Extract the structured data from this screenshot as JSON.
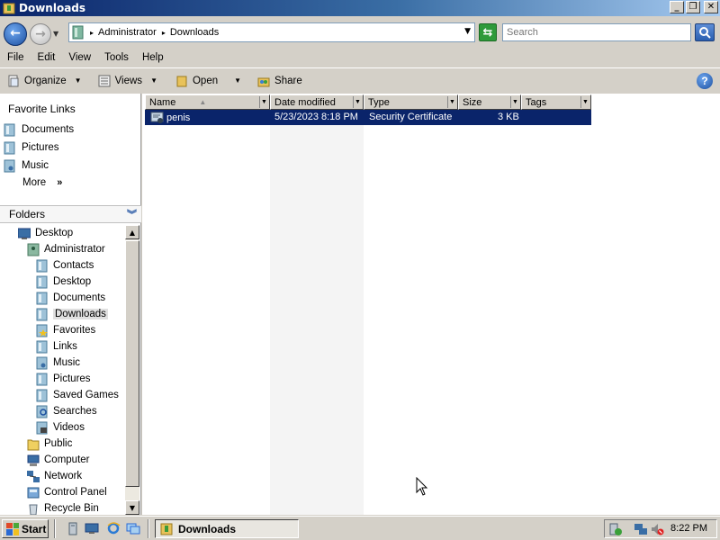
{
  "window": {
    "title": "Downloads",
    "buttons": {
      "minimize": "_",
      "maximize": "❐",
      "close": "✕"
    }
  },
  "address": {
    "crumbs": [
      "Administrator",
      "Downloads"
    ],
    "search_placeholder": "Search"
  },
  "menu": [
    "File",
    "Edit",
    "View",
    "Tools",
    "Help"
  ],
  "toolbar": {
    "organize": "Organize",
    "views": "Views",
    "open": "Open",
    "share": "Share",
    "help": "?"
  },
  "favorites": {
    "header": "Favorite Links",
    "items": [
      "Documents",
      "Pictures",
      "Music"
    ],
    "more": "More",
    "more_chevron": "»"
  },
  "folders": {
    "header": "Folders",
    "tree": [
      {
        "label": "Desktop",
        "level": 1,
        "icon": "desktop-icon"
      },
      {
        "label": "Administrator",
        "level": 2,
        "icon": "user-folder-icon"
      },
      {
        "label": "Contacts",
        "level": 3,
        "icon": "contacts-icon"
      },
      {
        "label": "Desktop",
        "level": 3,
        "icon": "desktop-folder-icon"
      },
      {
        "label": "Documents",
        "level": 3,
        "icon": "documents-icon"
      },
      {
        "label": "Downloads",
        "level": 3,
        "icon": "downloads-icon",
        "selected": true
      },
      {
        "label": "Favorites",
        "level": 3,
        "icon": "favorites-icon"
      },
      {
        "label": "Links",
        "level": 3,
        "icon": "links-icon"
      },
      {
        "label": "Music",
        "level": 3,
        "icon": "music-icon"
      },
      {
        "label": "Pictures",
        "level": 3,
        "icon": "pictures-icon"
      },
      {
        "label": "Saved Games",
        "level": 3,
        "icon": "saved-games-icon"
      },
      {
        "label": "Searches",
        "level": 3,
        "icon": "searches-icon"
      },
      {
        "label": "Videos",
        "level": 3,
        "icon": "videos-icon"
      },
      {
        "label": "Public",
        "level": 2,
        "icon": "folder-icon"
      },
      {
        "label": "Computer",
        "level": 2,
        "icon": "computer-icon"
      },
      {
        "label": "Network",
        "level": 2,
        "icon": "network-icon"
      },
      {
        "label": "Control Panel",
        "level": 2,
        "icon": "control-panel-icon"
      },
      {
        "label": "Recycle Bin",
        "level": 2,
        "icon": "recycle-bin-icon"
      }
    ]
  },
  "columns": {
    "name": "Name",
    "date": "Date modified",
    "type": "Type",
    "size": "Size",
    "tags": "Tags"
  },
  "files": [
    {
      "name": "penis",
      "date": "5/23/2023 8:18 PM",
      "type": "Security Certificate",
      "size": "3 KB",
      "tags": "",
      "icon": "certificate-icon",
      "selected": true
    }
  ],
  "taskbar": {
    "start": "Start",
    "active_window": "Downloads",
    "clock": "8:22 PM"
  },
  "colors": {
    "title_gradient_start": "#0a246a",
    "selection": "#0a246a",
    "chrome": "#d4d0c8"
  }
}
